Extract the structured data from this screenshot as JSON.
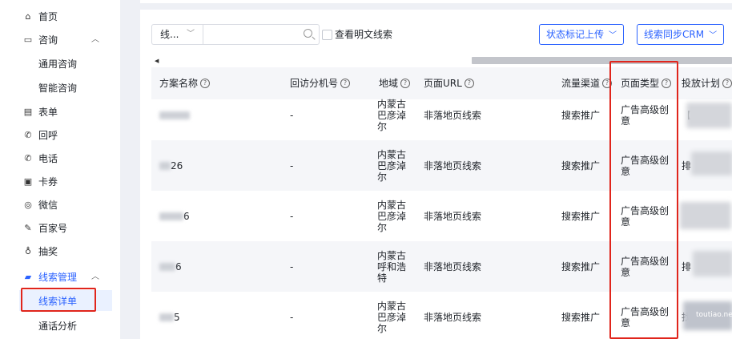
{
  "sidebar": {
    "items": [
      {
        "label": "首页",
        "icon": "home-icon",
        "glyph": "⌂"
      },
      {
        "label": "咨询",
        "icon": "chat-icon",
        "glyph": "▭",
        "expanded": true
      },
      {
        "label": "通用咨询",
        "sub": true
      },
      {
        "label": "智能咨询",
        "sub": true
      },
      {
        "label": "表单",
        "icon": "form-icon",
        "glyph": "▤"
      },
      {
        "label": "回呼",
        "icon": "callback-icon",
        "glyph": "✆"
      },
      {
        "label": "电话",
        "icon": "phone-icon",
        "glyph": "✆"
      },
      {
        "label": "卡券",
        "icon": "coupon-icon",
        "glyph": "▣"
      },
      {
        "label": "微信",
        "icon": "wechat-icon",
        "glyph": "◎"
      },
      {
        "label": "百家号",
        "icon": "baijiahao-icon",
        "glyph": "✎"
      },
      {
        "label": "抽奖",
        "icon": "lottery-icon",
        "glyph": "♁"
      },
      {
        "label": "线索管理",
        "icon": "lead-manage-icon",
        "glyph": "▰",
        "expanded": true,
        "highlight": true
      },
      {
        "label": "线索详单",
        "sub": true,
        "active": true
      },
      {
        "label": "通话分析",
        "sub": true
      }
    ],
    "chevron_glyph": "︿"
  },
  "filter": {
    "select_value": "线...",
    "select_chevron": "﹀",
    "search_value": "",
    "checkbox_label": "查看明文线索",
    "status_upload_label": "状态标记上传",
    "crm_sync_label": "线索同步CRM",
    "dropdown_glyph": "﹀"
  },
  "scroll_left_glyph": "◀",
  "table": {
    "columns": [
      {
        "label": "方案名称",
        "help": "?"
      },
      {
        "label": "回访分机号",
        "help": "?"
      },
      {
        "label": "地域",
        "help": "?"
      },
      {
        "label": "页面URL",
        "help": "?"
      },
      {
        "label": "流量渠道",
        "help": "?"
      },
      {
        "label": "页面类型",
        "help": "?"
      },
      {
        "label": "投放计划",
        "help": "?"
      }
    ],
    "rows": [
      {
        "name_suffix": "",
        "ext": "-",
        "region": "内蒙古巴彦淖尔",
        "url": "非落地页线索",
        "channel": "搜索推广",
        "page_type": "广告高级创意",
        "plan_hint": "【"
      },
      {
        "name_suffix": "26",
        "ext": "-",
        "region": "内蒙古巴彦淖尔",
        "url": "非落地页线索",
        "channel": "搜索推广",
        "page_type": "广告高级创意",
        "plan_hint": "排"
      },
      {
        "name_suffix": "6",
        "ext": "-",
        "region": "内蒙古巴彦淖尔",
        "url": "非落地页线索",
        "channel": "搜索推广",
        "page_type": "广告高级创意",
        "plan_hint": ""
      },
      {
        "name_suffix": "6",
        "ext": "-",
        "region": "内蒙古呼和浩特",
        "url": "非落地页线索",
        "channel": "搜索推广",
        "page_type": "广告高级创意",
        "plan_hint": "排"
      },
      {
        "name_suffix": "5",
        "ext": "-",
        "region": "内蒙古巴彦淖尔",
        "url": "非落地页线索",
        "channel": "搜索推广",
        "page_type": "广告高级创意",
        "plan_hint": "找"
      }
    ]
  },
  "watermark": "toutiao.net",
  "colors": {
    "accent": "#2c63ff",
    "highlight": "#e0251c",
    "sidebar_active_bg": "#eaf1ff"
  }
}
